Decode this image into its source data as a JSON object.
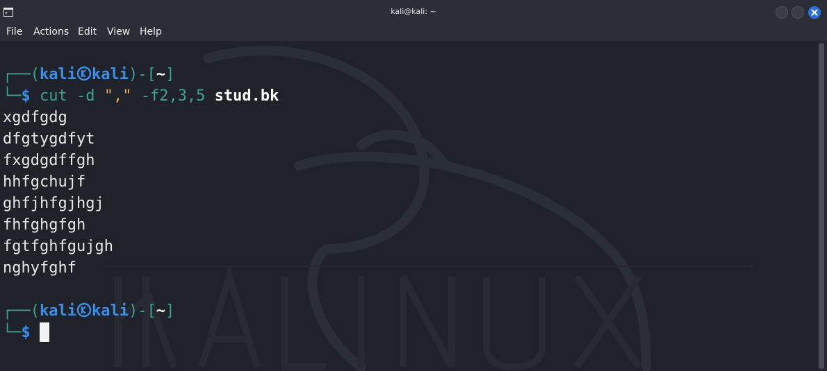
{
  "window": {
    "title": "kali@kali: ~"
  },
  "menu": [
    "File",
    "Actions",
    "Edit",
    "View",
    "Help"
  ],
  "prompt": {
    "corner_top": "┌──(",
    "user": "kali",
    "host": "kali",
    "close_paren": ")-[",
    "cwd": "~",
    "close_bracket": "]",
    "corner_bottom": "└─",
    "dollar": "$"
  },
  "command": {
    "prefix": "cut -d ",
    "delimiter": "\",\"",
    "fields": " -f2,3,5 ",
    "file": "stud.bk"
  },
  "output": [
    "xgdfgdg",
    "dfgtygdfyt",
    "fxgdgdffgh",
    "hhfgchujf",
    "ghfjhfgjhgj",
    "fhfghgfgh",
    "fgtfghfgujgh",
    "nghyfghf"
  ],
  "colors": {
    "prompt_line": "#3fa38d",
    "user_host": "#3b8eea",
    "background": "#1f2229",
    "close_button": "#2d6fe0"
  }
}
